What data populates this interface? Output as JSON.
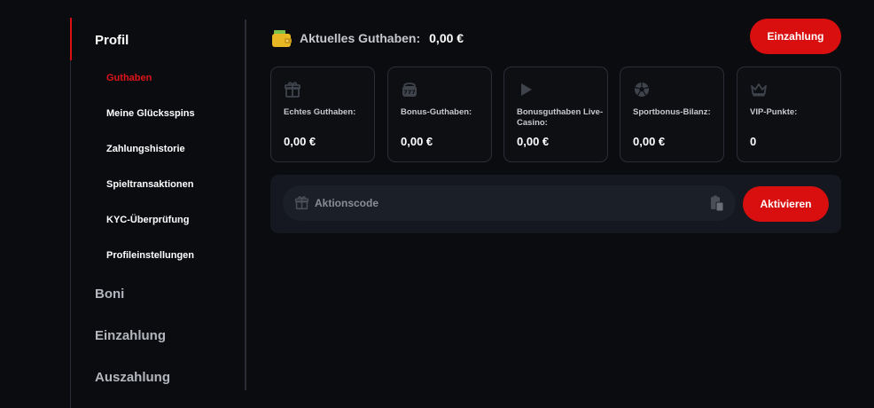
{
  "sidebar": {
    "main_items": [
      {
        "label": "Profil"
      },
      {
        "label": "Boni"
      },
      {
        "label": "Einzahlung"
      },
      {
        "label": "Auszahlung"
      }
    ],
    "sub_items": [
      {
        "label": "Guthaben"
      },
      {
        "label": "Meine Glücksspins"
      },
      {
        "label": "Zahlungshistorie"
      },
      {
        "label": "Spieltransaktionen"
      },
      {
        "label": "KYC-Überprüfung"
      },
      {
        "label": "Profileinstellungen"
      }
    ]
  },
  "balance": {
    "icon": "wallet-icon",
    "label": "Aktuelles Guthaben:",
    "value": "0,00 €"
  },
  "deposit_button": "Einzahlung",
  "cards": [
    {
      "icon": "gift-icon",
      "label": "Echtes Guthaben:",
      "value": "0,00 €"
    },
    {
      "icon": "slot-777-icon",
      "label": "Bonus-Guthaben:",
      "value": "0,00 €"
    },
    {
      "icon": "play-icon",
      "label": "Bonusguthaben Live-Casino:",
      "value": "0,00 €"
    },
    {
      "icon": "soccer-ball-icon",
      "label": "Sportbonus-Bilanz:",
      "value": "0,00 €"
    },
    {
      "icon": "crown-icon",
      "label": "VIP-Punkte:",
      "value": "0"
    }
  ],
  "promo": {
    "placeholder": "Aktionscode",
    "value": "",
    "button": "Aktivieren"
  },
  "colors": {
    "accent": "#d90f0f",
    "background": "#0b0c10",
    "card_border": "#2b2e36"
  }
}
